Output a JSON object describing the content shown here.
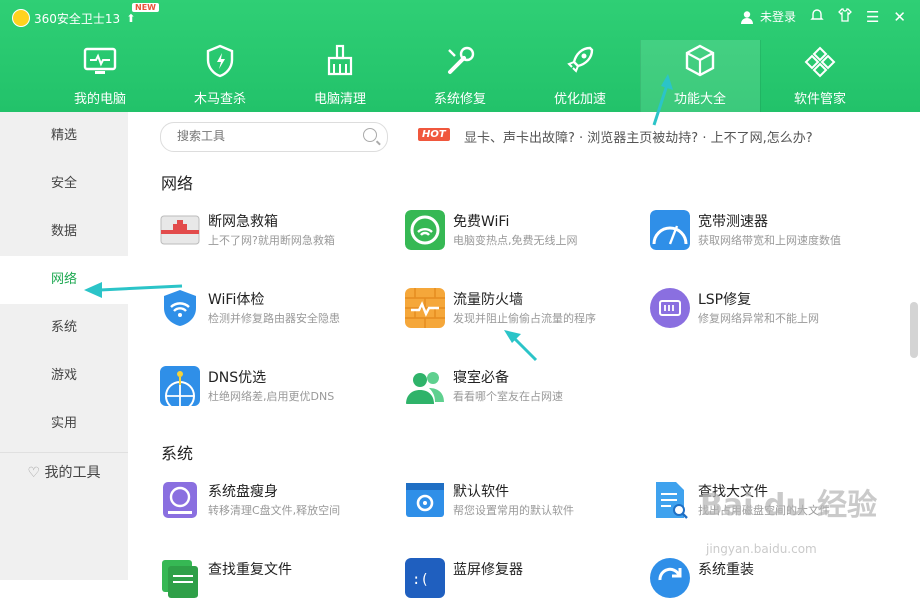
{
  "app": {
    "title": "360安全卫士13",
    "badge": "NEW"
  },
  "header": {
    "login": "未登录"
  },
  "nav": [
    {
      "label": "我的电脑"
    },
    {
      "label": "木马查杀"
    },
    {
      "label": "电脑清理"
    },
    {
      "label": "系统修复"
    },
    {
      "label": "优化加速"
    },
    {
      "label": "功能大全"
    },
    {
      "label": "软件管家"
    }
  ],
  "sidebar": {
    "items": [
      {
        "label": "精选"
      },
      {
        "label": "安全"
      },
      {
        "label": "数据"
      },
      {
        "label": "网络"
      },
      {
        "label": "系统"
      },
      {
        "label": "游戏"
      },
      {
        "label": "实用"
      }
    ],
    "footer": "我的工具"
  },
  "search": {
    "placeholder": "搜索工具"
  },
  "hot": {
    "badge": "HOT",
    "text": "显卡、声卡出故障? · 浏览器主页被劫持? · 上不了网,怎么办?"
  },
  "sections": {
    "network": "网络",
    "system": "系统"
  },
  "network_tools": [
    {
      "name": "断网急救箱",
      "desc": "上不了网?就用断网急救箱"
    },
    {
      "name": "免费WiFi",
      "desc": "电脑变热点,免费无线上网"
    },
    {
      "name": "宽带测速器",
      "desc": "获取网络带宽和上网速度数值"
    },
    {
      "name": "WiFi体检",
      "desc": "检测并修复路由器安全隐患"
    },
    {
      "name": "流量防火墙",
      "desc": "发现并阻止偷偷占流量的程序"
    },
    {
      "name": "LSP修复",
      "desc": "修复网络异常和不能上网"
    },
    {
      "name": "DNS优选",
      "desc": "杜绝网络差,启用更优DNS"
    },
    {
      "name": "寝室必备",
      "desc": "看看哪个室友在占网速"
    }
  ],
  "system_tools": [
    {
      "name": "系统盘瘦身",
      "desc": "转移清理C盘文件,释放空间"
    },
    {
      "name": "默认软件",
      "desc": "帮您设置常用的默认软件"
    },
    {
      "name": "查找大文件",
      "desc": "找出占用磁盘空间的大文件"
    },
    {
      "name": "查找重复文件",
      "desc": ""
    },
    {
      "name": "蓝屏修复器",
      "desc": ""
    },
    {
      "name": "系统重装",
      "desc": ""
    }
  ],
  "watermark": {
    "main": "Bai du 经验",
    "sub": "jingyan.baidu.com"
  },
  "colors": {
    "brand_green": "#22c26a",
    "active_text": "#1da851",
    "arrow": "#2bc4c8",
    "hot": "#f0573d"
  }
}
